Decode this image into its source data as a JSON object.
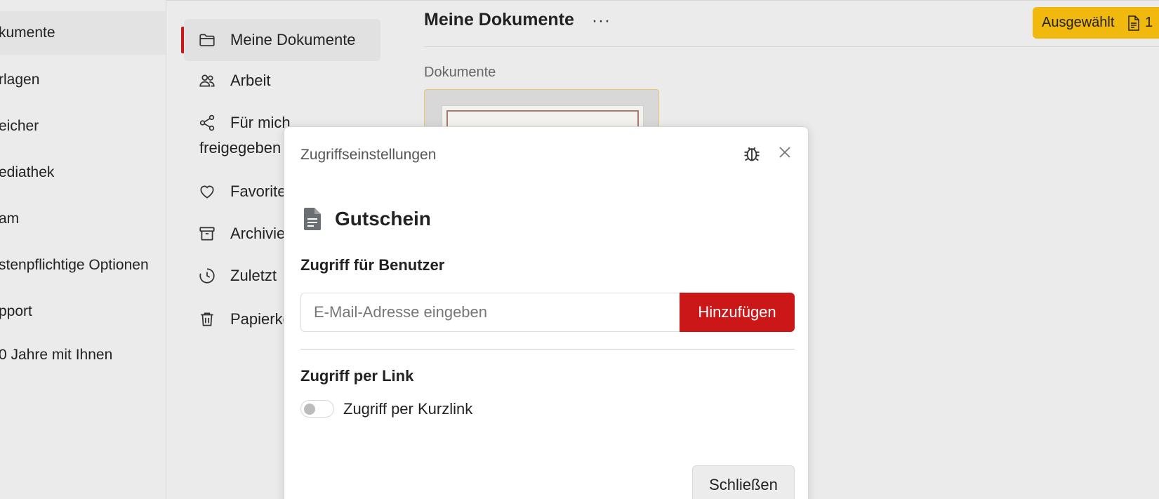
{
  "left_sidebar": {
    "items": [
      {
        "label": "kumente"
      },
      {
        "label": "rlagen"
      },
      {
        "label": "eicher"
      },
      {
        "label": "ediathek"
      },
      {
        "label": "am"
      },
      {
        "label": "stenpflichtige Optionen"
      },
      {
        "label": "pport"
      },
      {
        "label": "0 Jahre mit Ihnen"
      }
    ]
  },
  "nav": {
    "items": [
      {
        "label": "Meine Dokumente",
        "icon": "folder-icon"
      },
      {
        "label": "Arbeit",
        "icon": "users-icon"
      },
      {
        "label": "Für mich",
        "label2": "freigegeben",
        "icon": "share-icon"
      },
      {
        "label": "Favoriten",
        "icon": "heart-icon"
      },
      {
        "label": "Archiviert",
        "icon": "archive-icon"
      },
      {
        "label": "Zuletzt",
        "icon": "clock-icon"
      },
      {
        "label": "Papierkorb",
        "icon": "trash-icon"
      }
    ]
  },
  "main": {
    "title": "Meine Dokumente",
    "more": "···",
    "selected_label": "Ausgewählt",
    "selected_count": "1",
    "section_label": "Dokumente"
  },
  "modal": {
    "title": "Zugriffseinstellungen",
    "doc_name": "Gutschein",
    "user_access_heading": "Zugriff für Benutzer",
    "email_placeholder": "E-Mail-Adresse eingeben",
    "add_label": "Hinzufügen",
    "link_access_heading": "Zugriff per Link",
    "shortlink_label": "Zugriff per Kurzlink",
    "close_label": "Schließen"
  },
  "colors": {
    "accent_red": "#cc1719",
    "accent_yellow": "#f1b80d"
  }
}
